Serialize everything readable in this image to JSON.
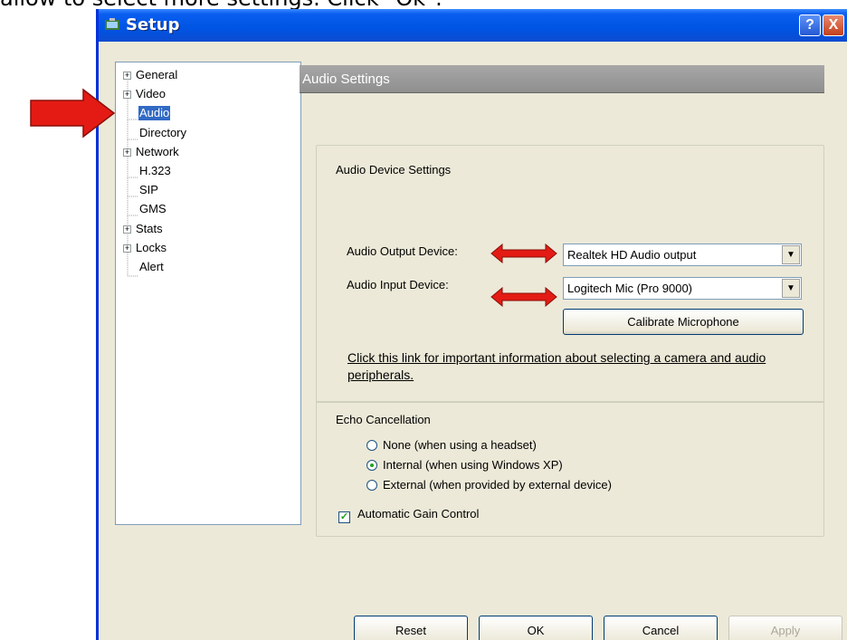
{
  "caption": "allow to select more settings.  Click \"Ok\".",
  "window": {
    "title": "Setup",
    "help": "?",
    "close": "X"
  },
  "tree": [
    {
      "label": "General",
      "expandable": true
    },
    {
      "label": "Video",
      "expandable": true
    },
    {
      "label": "Audio",
      "expandable": false,
      "selected": true
    },
    {
      "label": "Directory",
      "expandable": false
    },
    {
      "label": "Network",
      "expandable": true
    },
    {
      "label": "H.323",
      "expandable": false
    },
    {
      "label": "SIP",
      "expandable": false
    },
    {
      "label": "GMS",
      "expandable": false
    },
    {
      "label": "Stats",
      "expandable": true
    },
    {
      "label": "Locks",
      "expandable": true
    },
    {
      "label": "Alert",
      "expandable": false
    }
  ],
  "header": {
    "title": "Audio Settings"
  },
  "device": {
    "group_title": "Audio Device Settings",
    "output_label": "Audio Output Device:",
    "output_value": "Realtek HD Audio output",
    "input_label": "Audio Input Device:",
    "input_value": "Logitech Mic (Pro 9000)",
    "calibrate": "Calibrate Microphone",
    "link": "Click this link for important information about selecting a camera and audio peripherals."
  },
  "echo": {
    "title": "Echo Cancellation",
    "options": [
      {
        "label": "None (when using a headset)",
        "selected": false
      },
      {
        "label": "Internal (when using Windows XP)",
        "selected": true
      },
      {
        "label": "External (when provided by external device)",
        "selected": false
      }
    ],
    "agc_label": "Automatic Gain Control",
    "agc_checked": true
  },
  "buttons": {
    "reset": "Reset",
    "ok": "OK",
    "cancel": "Cancel",
    "apply": "Apply"
  },
  "colors": {
    "arrow": "#e31b14",
    "selection": "#316ac5",
    "titlebar": "#0054e3"
  }
}
